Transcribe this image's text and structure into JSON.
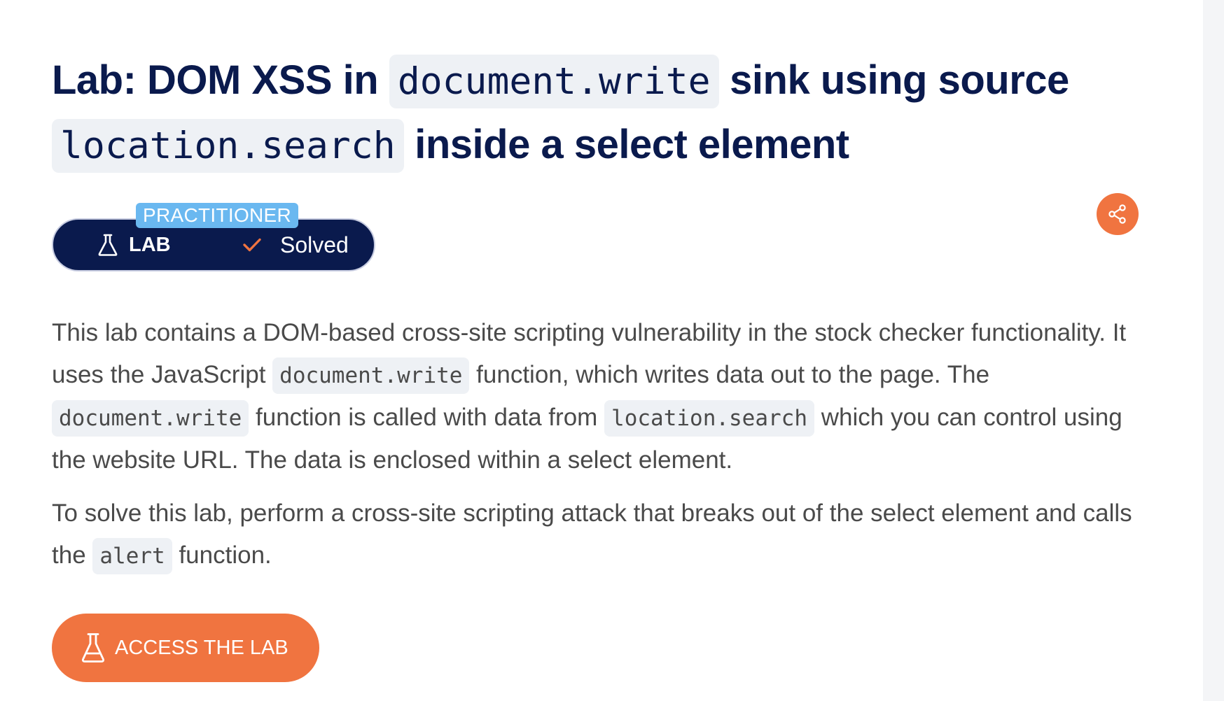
{
  "title": {
    "prefix": "Lab: DOM XSS in ",
    "code1": "document.write",
    "middle": " sink using source ",
    "code2": "location.search",
    "suffix": " inside a select element"
  },
  "badge": {
    "level": "PRACTITIONER",
    "type": "LAB",
    "status": "Solved"
  },
  "description": {
    "p1": {
      "t1": "This lab contains a DOM-based cross-site scripting vulnerability in the stock checker functionality. It uses the JavaScript ",
      "c1": "document.write",
      "t2": " function, which writes data out to the page. The ",
      "c2": "document.write",
      "t3": " function is called with data from ",
      "c3": "location.search",
      "t4": " which you can control using the website URL. The data is enclosed within a select element."
    },
    "p2": {
      "t1": "To solve this lab, perform a cross-site scripting attack that breaks out of the select element and calls the ",
      "c1": "alert",
      "t2": " function."
    }
  },
  "access_button": {
    "label": "ACCESS THE LAB"
  },
  "icons": {
    "share": "share-icon",
    "flask": "flask-icon",
    "check": "check-icon"
  },
  "colors": {
    "navy": "#0a1a4d",
    "orange": "#f07440",
    "level_blue": "#6ab8f0",
    "code_bg": "#eef1f5",
    "body_text": "#4a4a4a"
  }
}
